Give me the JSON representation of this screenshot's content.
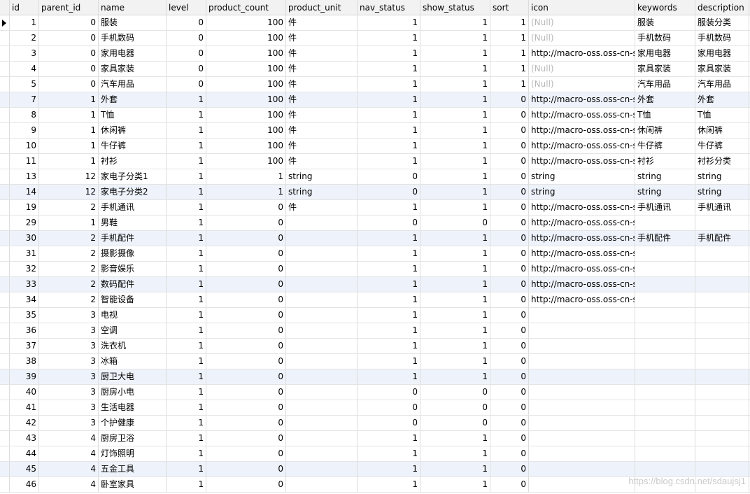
{
  "columns": [
    "id",
    "parent_id",
    "name",
    "level",
    "product_count",
    "product_unit",
    "nav_status",
    "show_status",
    "sort",
    "icon",
    "keywords",
    "description"
  ],
  "rows": [
    [
      "1",
      "0",
      "服装",
      "0",
      "100",
      "件",
      "1",
      "1",
      "1",
      "(Null)",
      "服装",
      "服装分类"
    ],
    [
      "2",
      "0",
      "手机数码",
      "0",
      "100",
      "件",
      "1",
      "1",
      "1",
      "(Null)",
      "手机数码",
      "手机数码"
    ],
    [
      "3",
      "0",
      "家用电器",
      "0",
      "100",
      "件",
      "1",
      "1",
      "1",
      "http://macro-oss.oss-cn-s",
      "家用电器",
      "家用电器"
    ],
    [
      "4",
      "0",
      "家具家装",
      "0",
      "100",
      "件",
      "1",
      "1",
      "1",
      "(Null)",
      "家具家装",
      "家具家装"
    ],
    [
      "5",
      "0",
      "汽车用品",
      "0",
      "100",
      "件",
      "1",
      "1",
      "1",
      "(Null)",
      "汽车用品",
      "汽车用品"
    ],
    [
      "7",
      "1",
      "外套",
      "1",
      "100",
      "件",
      "1",
      "1",
      "0",
      "http://macro-oss.oss-cn-s",
      "外套",
      "外套"
    ],
    [
      "8",
      "1",
      "T恤",
      "1",
      "100",
      "件",
      "1",
      "1",
      "0",
      "http://macro-oss.oss-cn-s",
      "T恤",
      "T恤"
    ],
    [
      "9",
      "1",
      "休闲裤",
      "1",
      "100",
      "件",
      "1",
      "1",
      "0",
      "http://macro-oss.oss-cn-s",
      "休闲裤",
      "休闲裤"
    ],
    [
      "10",
      "1",
      "牛仔裤",
      "1",
      "100",
      "件",
      "1",
      "1",
      "0",
      "http://macro-oss.oss-cn-s",
      "牛仔裤",
      "牛仔裤"
    ],
    [
      "11",
      "1",
      "衬衫",
      "1",
      "100",
      "件",
      "1",
      "1",
      "0",
      "http://macro-oss.oss-cn-s",
      "衬衫",
      "衬衫分类"
    ],
    [
      "13",
      "12",
      "家电子分类1",
      "1",
      "1",
      "string",
      "0",
      "1",
      "0",
      "string",
      "string",
      "string"
    ],
    [
      "14",
      "12",
      "家电子分类2",
      "1",
      "1",
      "string",
      "0",
      "1",
      "0",
      "string",
      "string",
      "string"
    ],
    [
      "19",
      "2",
      "手机通讯",
      "1",
      "0",
      "件",
      "1",
      "1",
      "0",
      "http://macro-oss.oss-cn-s",
      "手机通讯",
      "手机通讯"
    ],
    [
      "29",
      "1",
      "男鞋",
      "1",
      "0",
      "",
      "0",
      "0",
      "0",
      "http://macro-oss.oss-cn-s",
      "",
      ""
    ],
    [
      "30",
      "2",
      "手机配件",
      "1",
      "0",
      "",
      "1",
      "1",
      "0",
      "http://macro-oss.oss-cn-s",
      "手机配件",
      "手机配件"
    ],
    [
      "31",
      "2",
      "摄影摄像",
      "1",
      "0",
      "",
      "1",
      "1",
      "0",
      "http://macro-oss.oss-cn-s",
      "",
      ""
    ],
    [
      "32",
      "2",
      "影音娱乐",
      "1",
      "0",
      "",
      "1",
      "1",
      "0",
      "http://macro-oss.oss-cn-s",
      "",
      ""
    ],
    [
      "33",
      "2",
      "数码配件",
      "1",
      "0",
      "",
      "1",
      "1",
      "0",
      "http://macro-oss.oss-cn-s",
      "",
      ""
    ],
    [
      "34",
      "2",
      "智能设备",
      "1",
      "0",
      "",
      "1",
      "1",
      "0",
      "http://macro-oss.oss-cn-s",
      "",
      ""
    ],
    [
      "35",
      "3",
      "电视",
      "1",
      "0",
      "",
      "1",
      "1",
      "0",
      "",
      "",
      ""
    ],
    [
      "36",
      "3",
      "空调",
      "1",
      "0",
      "",
      "1",
      "1",
      "0",
      "",
      "",
      ""
    ],
    [
      "37",
      "3",
      "洗衣机",
      "1",
      "0",
      "",
      "1",
      "1",
      "0",
      "",
      "",
      ""
    ],
    [
      "38",
      "3",
      "冰箱",
      "1",
      "0",
      "",
      "1",
      "1",
      "0",
      "",
      "",
      ""
    ],
    [
      "39",
      "3",
      "厨卫大电",
      "1",
      "0",
      "",
      "1",
      "1",
      "0",
      "",
      "",
      ""
    ],
    [
      "40",
      "3",
      "厨房小电",
      "1",
      "0",
      "",
      "0",
      "0",
      "0",
      "",
      "",
      ""
    ],
    [
      "41",
      "3",
      "生活电器",
      "1",
      "0",
      "",
      "0",
      "0",
      "0",
      "",
      "",
      ""
    ],
    [
      "42",
      "3",
      "个护健康",
      "1",
      "0",
      "",
      "0",
      "0",
      "0",
      "",
      "",
      ""
    ],
    [
      "43",
      "4",
      "厨房卫浴",
      "1",
      "0",
      "",
      "1",
      "1",
      "0",
      "",
      "",
      ""
    ],
    [
      "44",
      "4",
      "灯饰照明",
      "1",
      "0",
      "",
      "1",
      "1",
      "0",
      "",
      "",
      ""
    ],
    [
      "45",
      "4",
      "五金工具",
      "1",
      "0",
      "",
      "1",
      "1",
      "0",
      "",
      "",
      ""
    ],
    [
      "46",
      "4",
      "卧室家具",
      "1",
      "0",
      "",
      "1",
      "1",
      "0",
      "",
      "",
      ""
    ]
  ],
  "selected_row": 0,
  "highlighted_rows": [
    5,
    11,
    14,
    17,
    23,
    29
  ],
  "null_text": "(Null)",
  "watermark": "https://blog.csdn.net/sdaujsj1",
  "colors": {
    "header_bg": "#f2f2f2",
    "highlight_row": "#eef3fb",
    "null_text": "#b7b7b7"
  }
}
